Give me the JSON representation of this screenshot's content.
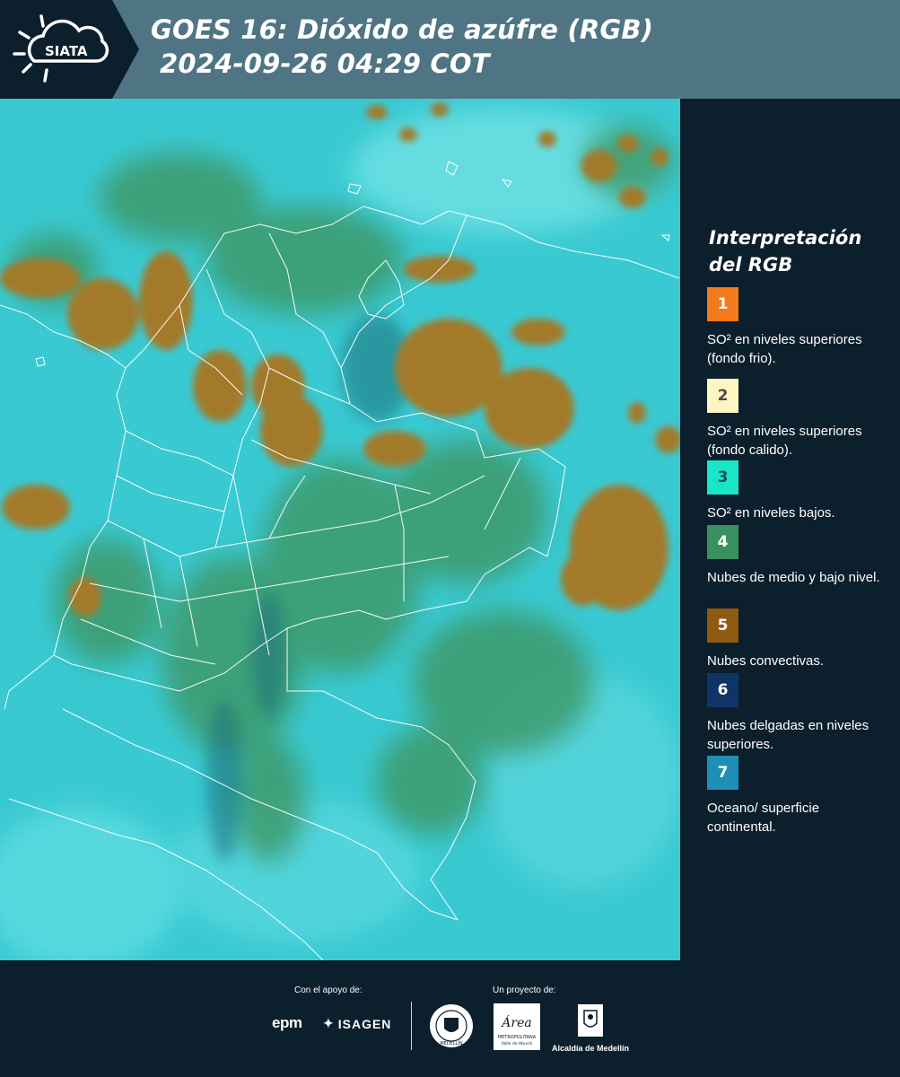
{
  "header": {
    "logo_text": "SIATA",
    "title_line1": "GOES 16: Dióxido de azúfre (RGB)",
    "title_line2": "2024-09-26 04:29 COT"
  },
  "legend": {
    "title": "Interpretación del RGB",
    "items": [
      {
        "number": "1",
        "color": "#f47a1b",
        "text_color": "#ffffff",
        "label": "SO² en niveles superiores (fondo frio)."
      },
      {
        "number": "2",
        "color": "#fdf5c2",
        "text_color": "#4b4b4b",
        "label": "SO² en niveles superiores (fondo calido)."
      },
      {
        "number": "3",
        "color": "#19e6c9",
        "text_color": "#1f4f55",
        "label": "SO² en niveles bajos."
      },
      {
        "number": "4",
        "color": "#3a9160",
        "text_color": "#ffffff",
        "label": "Nubes de medio y bajo nivel."
      },
      {
        "number": "5",
        "color": "#8f5a12",
        "text_color": "#ffffff",
        "label": "Nubes convectivas."
      },
      {
        "number": "6",
        "color": "#0e3468",
        "text_color": "#ffffff",
        "label": "Nubes delgadas en niveles superiores."
      },
      {
        "number": "7",
        "color": "#1d8fb6",
        "text_color": "#ffffff",
        "label": "Oceano/ superficie continental."
      }
    ]
  },
  "footer": {
    "support_label": "Con el apoyo de:",
    "project_label": "Un proyecto de:",
    "epm": "epm",
    "isagen": "ISAGEN",
    "amva_text": "Área",
    "amva_sub": "METROPOLITANA",
    "amva_sub2": "Valle de Aburrá",
    "alcaldia": "Alcaldía de Medellín",
    "seal_text": "MEDELLÍN"
  }
}
